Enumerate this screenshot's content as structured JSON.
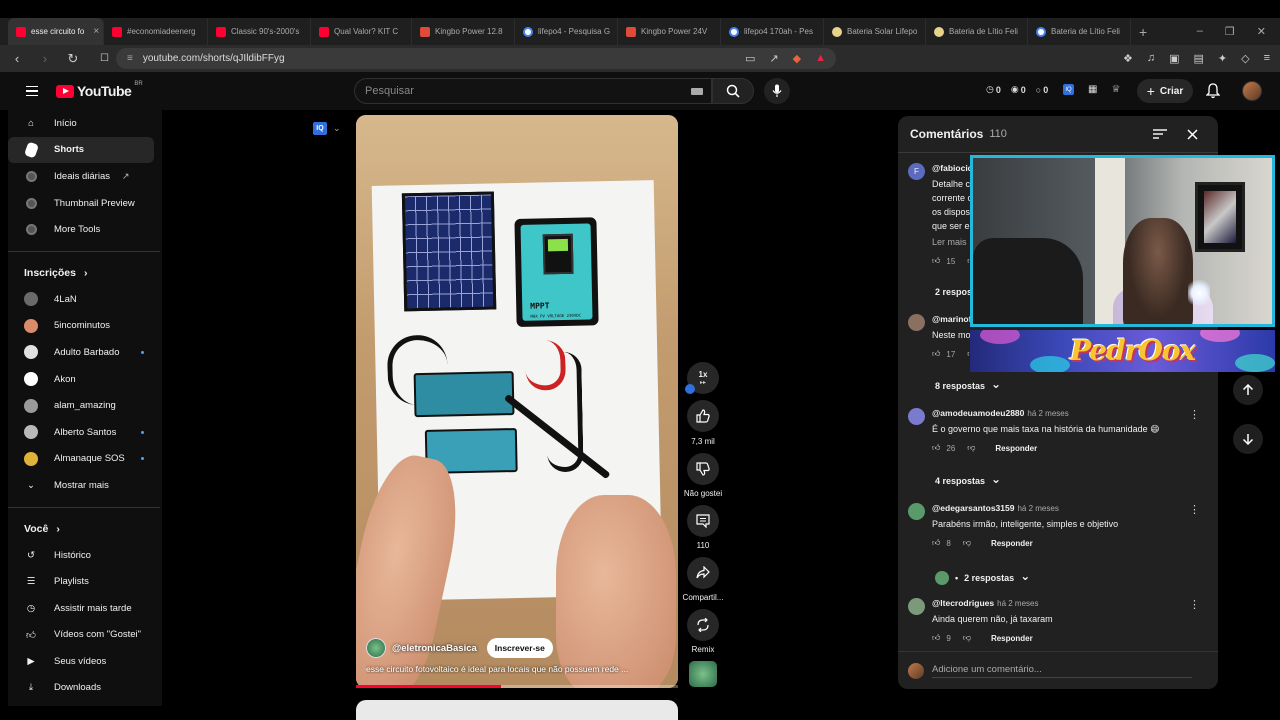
{
  "browser": {
    "tabs": [
      {
        "label": "esse circuito fo",
        "icon": "youtube-icon",
        "active": true
      },
      {
        "label": "#economiadeenerg",
        "icon": "youtube-icon"
      },
      {
        "label": "Classic 90's-2000's",
        "icon": "youtube-icon"
      },
      {
        "label": "Qual Valor? KIT C",
        "icon": "youtube-icon"
      },
      {
        "label": "Kingbo Power 12.8",
        "icon": "kingbo-icon"
      },
      {
        "label": "lifepo4 - Pesquisa G",
        "icon": "google-icon"
      },
      {
        "label": "Kingbo Power 24V",
        "icon": "kingbo-icon"
      },
      {
        "label": "lifepo4 170ah - Pes",
        "icon": "google-icon"
      },
      {
        "label": "Bateria Solar Lifepo",
        "icon": "store-icon"
      },
      {
        "label": "Bateria de Lítio Feli",
        "icon": "store-icon"
      },
      {
        "label": "Bateria de Lítio Feli",
        "icon": "google-icon"
      }
    ],
    "url": "youtube.com/shorts/qJIldibFFyg"
  },
  "masthead": {
    "logo_text": "YouTube",
    "country_code": "BR",
    "search_placeholder": "Pesquisar",
    "stats": [
      "0",
      "0",
      "0"
    ],
    "create_label": "Criar"
  },
  "sidebar": {
    "main": [
      {
        "label": "Início",
        "icon": "home-icon"
      },
      {
        "label": "Shorts",
        "icon": "shorts-icon",
        "active": true
      },
      {
        "label": "Ideais diárias",
        "icon": "extension-icon",
        "external": true
      },
      {
        "label": "Thumbnail Preview",
        "icon": "extension-icon"
      },
      {
        "label": "More Tools",
        "icon": "extension-icon"
      }
    ],
    "subscriptions_title": "Inscrições",
    "subscriptions": [
      {
        "label": "4LaN",
        "color": "#6a6a6a",
        "dot": false
      },
      {
        "label": "5incominutos",
        "color": "#d98b6a",
        "dot": false
      },
      {
        "label": "Adulto Barbado",
        "color": "#e0e0e0",
        "dot": true
      },
      {
        "label": "Akon",
        "color": "#ffffff",
        "dot": false
      },
      {
        "label": "alam_amazing",
        "color": "#9a9a9a",
        "dot": false
      },
      {
        "label": "Alberto Santos",
        "color": "#b9b9b9",
        "dot": true
      },
      {
        "label": "Almanaque SOS",
        "color": "#e0b23a",
        "dot": true
      }
    ],
    "show_more": "Mostrar mais",
    "you_title": "Você",
    "you_items": [
      {
        "label": "Histórico",
        "icon": "history-icon"
      },
      {
        "label": "Playlists",
        "icon": "playlists-icon"
      },
      {
        "label": "Assistir mais tarde",
        "icon": "watch-later-icon"
      },
      {
        "label": "Vídeos com \"Gostei\"",
        "icon": "like-icon"
      },
      {
        "label": "Seus vídeos",
        "icon": "your-videos-icon"
      },
      {
        "label": "Downloads",
        "icon": "download-icon"
      }
    ]
  },
  "video": {
    "channel": "@eletronicaBasica",
    "subscribe_label": "Inscrever-se",
    "title": "esse circuito fotovoltaico é ideal para locais que não possuem rede ...",
    "drawing_label": "MPPT",
    "drawing_sublabel": "MAX PV VOLTAGE 230VDC",
    "progress": 0.45
  },
  "rail": {
    "speed": "1x",
    "likes": "7,3 mil",
    "dislike_label": "Não gostei",
    "comments": "110",
    "share_label": "Compartil...",
    "remix_label": "Remix"
  },
  "comments": {
    "title": "Comentários",
    "count": "110",
    "items": [
      {
        "author": "@fabiocic",
        "age": "",
        "lines": [
          "Detalhe c",
          "corrente c",
          "os dispos",
          "que ser e"
        ],
        "more": "Ler mais",
        "likes": "15",
        "avatar_letter": "F",
        "avatar_color": "#5c6bc0",
        "replies": "2 respos"
      },
      {
        "author": "@marinof",
        "age": "",
        "lines": [
          "Neste mo"
        ],
        "likes": "17",
        "avatar_color": "#8a7060",
        "replies": "8 respostas"
      },
      {
        "author": "@amodeuamodeu2880",
        "age": "há 2 meses",
        "lines": [
          "É o governo que mais taxa na história da humanidade 😄"
        ],
        "likes": "26",
        "reply_label": "Responder",
        "avatar_color": "#7a7acf",
        "replies": "4 respostas"
      },
      {
        "author": "@edegarsantos3159",
        "age": "há 2 meses",
        "lines": [
          "Parabéns irmão, inteligente, simples e objetivo"
        ],
        "likes": "8",
        "reply_label": "Responder",
        "avatar_color": "#5a9a6a",
        "replies": "2 respostas"
      },
      {
        "author": "@ltecrodrigues",
        "age": "há 2 meses",
        "lines": [
          "Ainda querem não, já taxaram"
        ],
        "likes": "9",
        "reply_label": "Responder",
        "avatar_color": "#7a9a7a"
      }
    ],
    "add_placeholder": "Adicione um comentário..."
  },
  "overlay": {
    "banner_text": "PedrOox"
  },
  "colors": {
    "accent": "#ff0033",
    "webcam_border": "#23b8dc",
    "link_blue": "#3ea6ff"
  }
}
